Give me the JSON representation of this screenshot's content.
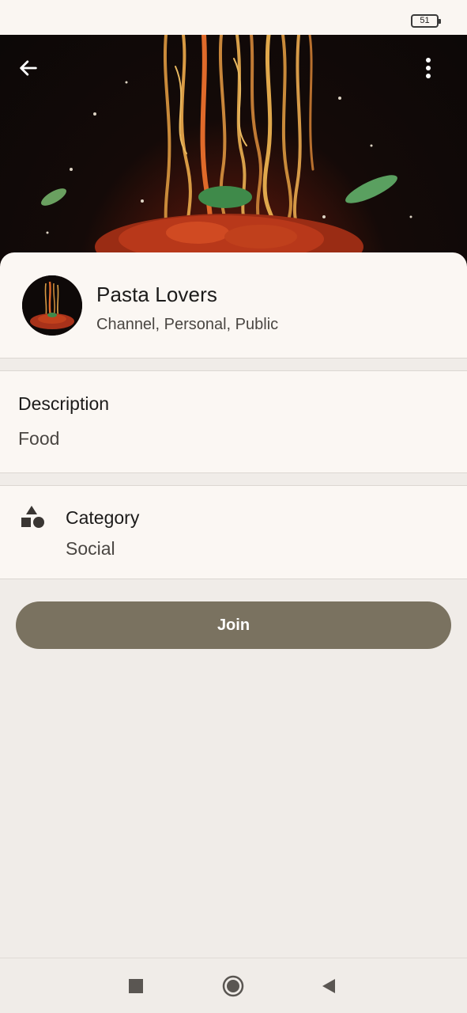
{
  "status_bar": {
    "battery": "51"
  },
  "header": {
    "back_icon": "arrow-left-icon",
    "more_icon": "more-vert-icon"
  },
  "channel": {
    "name": "Pasta Lovers",
    "meta": "Channel, Personal, Public"
  },
  "description": {
    "title": "Description",
    "value": "Food"
  },
  "category": {
    "icon": "shapes-icon",
    "title": "Category",
    "value": "Social"
  },
  "actions": {
    "join_label": "Join",
    "join_color": "#7a7260"
  },
  "nav_bar": {
    "recents_icon": "square-icon",
    "home_icon": "circle-icon",
    "back_icon": "triangle-back-icon"
  }
}
